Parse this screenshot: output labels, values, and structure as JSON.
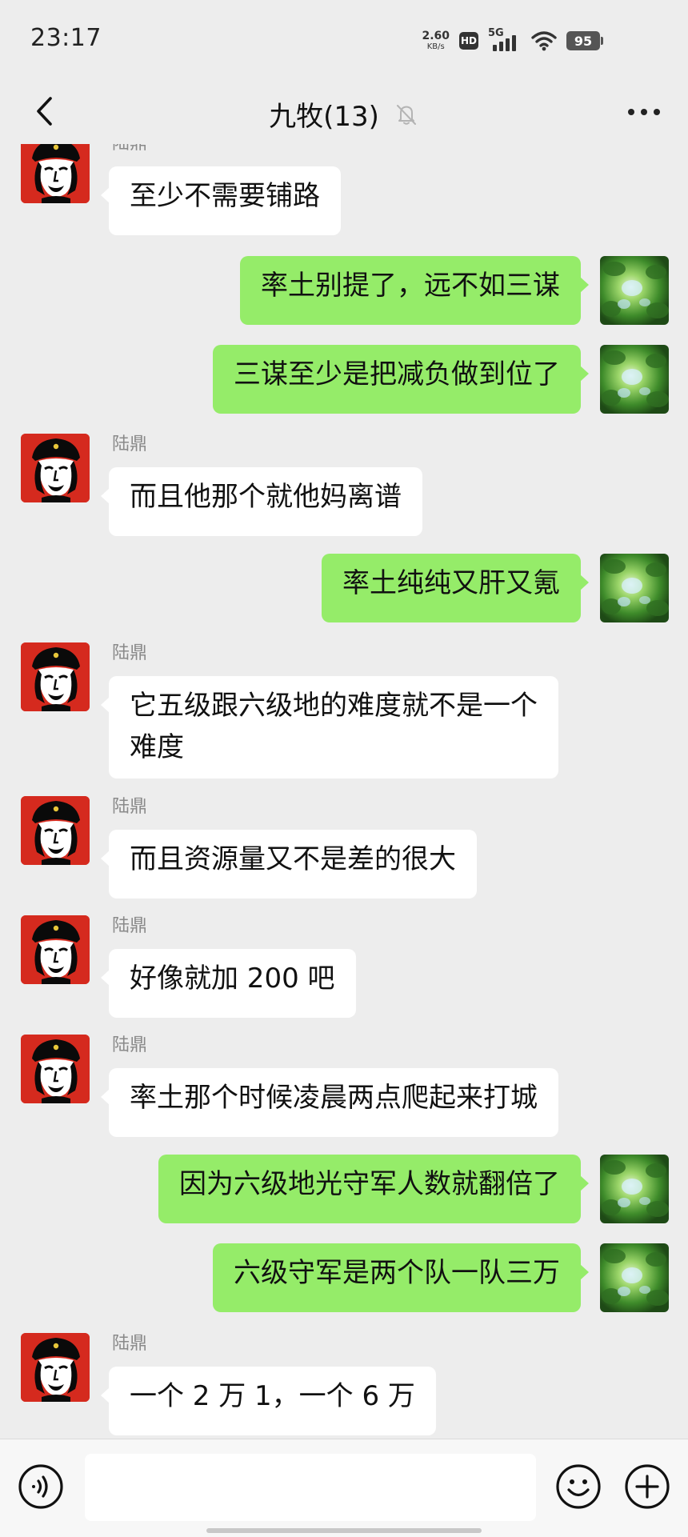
{
  "status_bar": {
    "time": "23:17",
    "net_speed_value": "2.60",
    "net_speed_unit": "KB/s",
    "hd_label": "HD",
    "network_label": "5G",
    "battery": "95"
  },
  "header": {
    "title": "九牧(13)",
    "muted": true
  },
  "messages": [
    {
      "side": "in",
      "sender": "陆鼎",
      "text": "至少不需要铺路"
    },
    {
      "side": "out",
      "text": "率土别提了，远不如三谋"
    },
    {
      "side": "out",
      "text": "三谋至少是把减负做到位了"
    },
    {
      "side": "in",
      "sender": "陆鼎",
      "text": "而且他那个就他妈离谱"
    },
    {
      "side": "out",
      "text": "率土纯纯又肝又氪"
    },
    {
      "side": "in",
      "sender": "陆鼎",
      "text": "它五级跟六级地的难度就不是一个\n难度"
    },
    {
      "side": "in",
      "sender": "陆鼎",
      "text": "而且资源量又不是差的很大"
    },
    {
      "side": "in",
      "sender": "陆鼎",
      "text": "好像就加 200 吧"
    },
    {
      "side": "in",
      "sender": "陆鼎",
      "text": "率土那个时候凌晨两点爬起来打城"
    },
    {
      "side": "out",
      "text": "因为六级地光守军人数就翻倍了"
    },
    {
      "side": "out",
      "text": "六级守军是两个队一队三万"
    },
    {
      "side": "in",
      "sender": "陆鼎",
      "text": "一个 2 万 1，一个 6 万"
    }
  ],
  "input_bar": {
    "placeholder": "",
    "value": ""
  },
  "colors": {
    "background": "#EDEDED",
    "bubble_in": "#FFFFFF",
    "bubble_out": "#95EC69",
    "sender_name": "#8A8A8A"
  }
}
